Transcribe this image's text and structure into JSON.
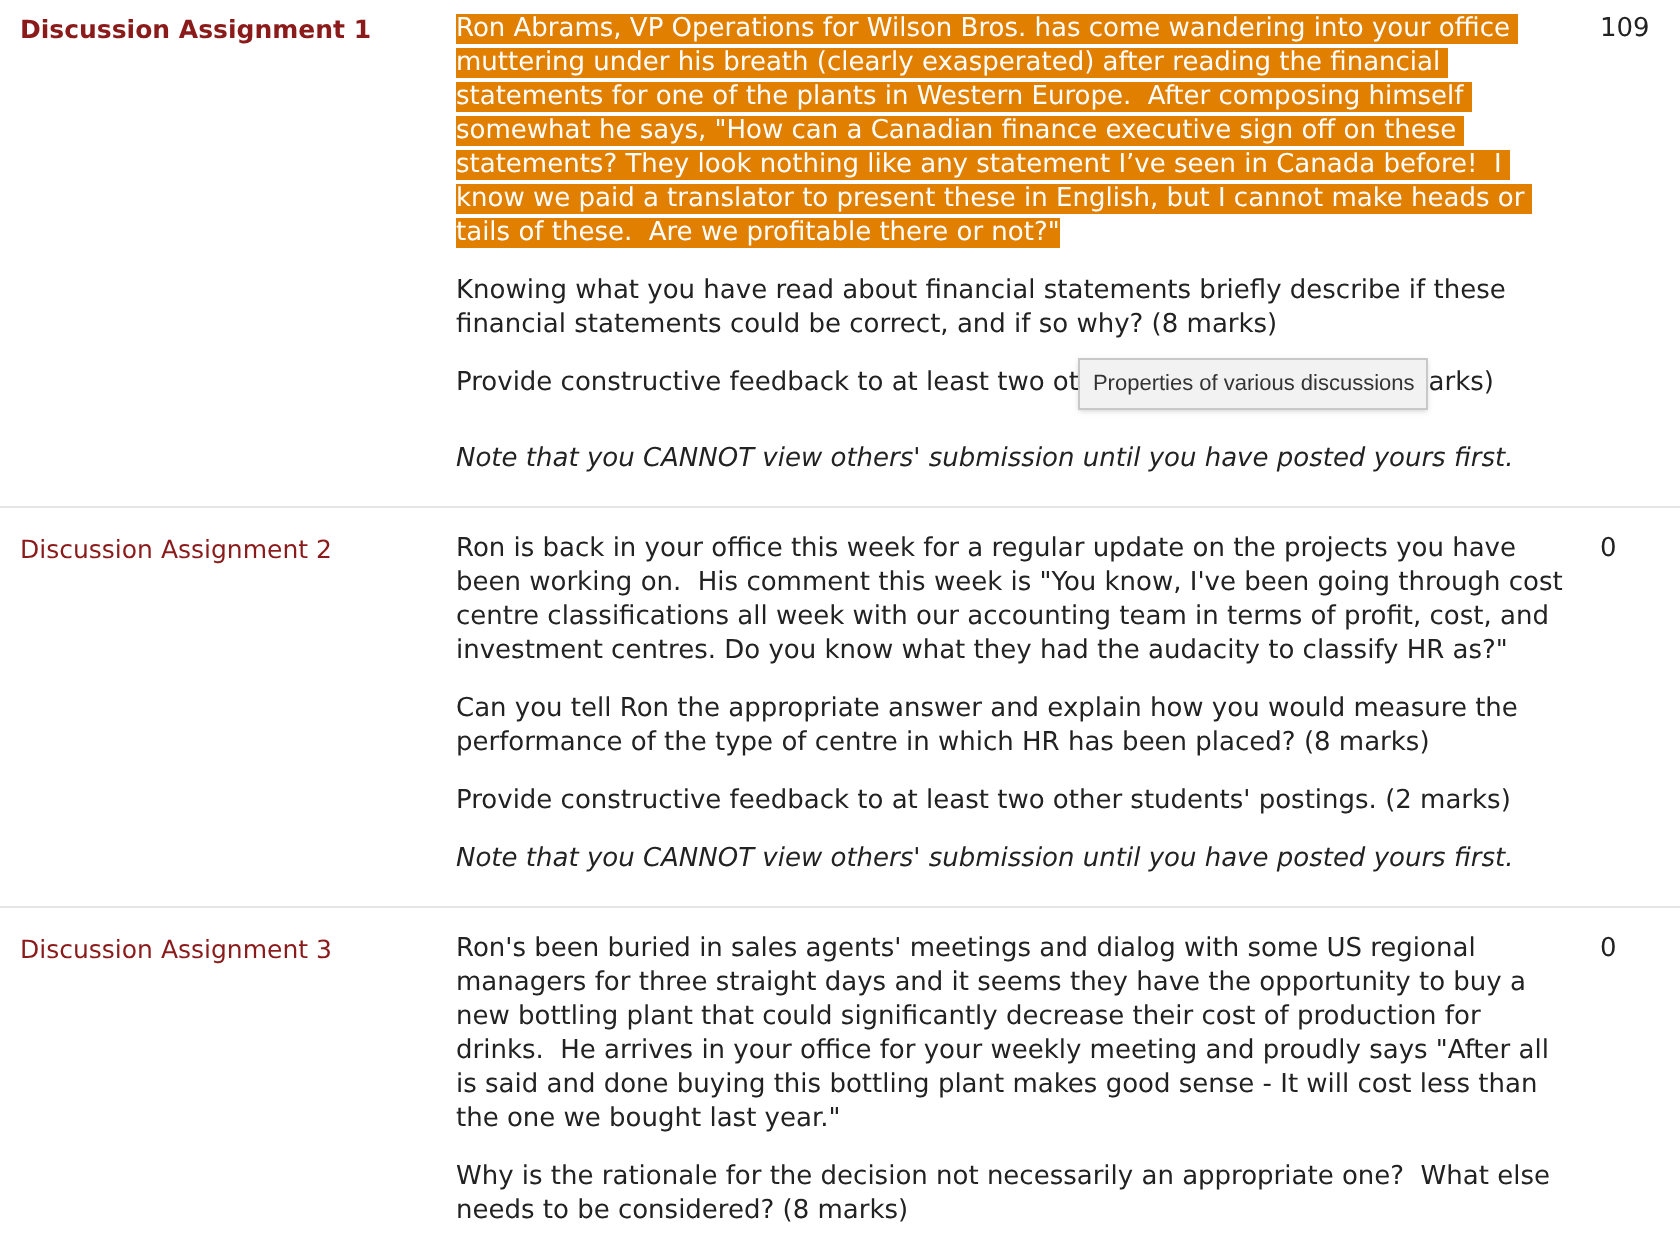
{
  "rows": [
    {
      "title": "Discussion Assignment 1",
      "selected": true,
      "count": "109",
      "paragraphs": [
        {
          "kind": "text",
          "highlighted": true,
          "text": "Ron Abrams, VP Operations for Wilson Bros. has come wandering into your office muttering under his breath (clearly exasperated) after reading the financial statements for one of the plants in Western Europe.  After composing himself somewhat he says, \"How can a Canadian finance executive sign off on these statements? They look nothing like any statement I’ve seen in Canada before!  I know we paid a translator to present these in English, but I cannot make heads or tails of these.  Are we profitable there or not?\""
        },
        {
          "kind": "text",
          "highlighted": false,
          "text": "Knowing what you have read about financial statements briefly describe if these financial statements could be correct, and if so why? (8 marks)"
        },
        {
          "kind": "covered",
          "before": "Provide constructive feedback to at least two ot",
          "tooltip": "Properties of various discussions",
          "after": "arks)"
        },
        {
          "kind": "note",
          "text": "Note that you CANNOT view others' submission until you have posted yours first."
        }
      ]
    },
    {
      "title": "Discussion Assignment 2",
      "selected": false,
      "count": "0",
      "paragraphs": [
        {
          "kind": "text",
          "highlighted": false,
          "text": "Ron is back in your office this week for a regular update on the projects you have been working on.  His comment this week is \"You know, I've been going through cost centre classifications all week with our accounting team in terms of profit, cost, and investment centres. Do you know what they had the audacity to classify HR as?\""
        },
        {
          "kind": "text",
          "highlighted": false,
          "text": "Can you tell Ron the appropriate answer and explain how you would measure the performance of the type of centre in which HR has been placed? (8 marks)"
        },
        {
          "kind": "text",
          "highlighted": false,
          "text": "Provide constructive feedback to at least two other students' postings. (2 marks)"
        },
        {
          "kind": "note",
          "text": "Note that you CANNOT view others' submission until you have posted yours first."
        }
      ]
    },
    {
      "title": "Discussion Assignment 3",
      "selected": false,
      "count": "0",
      "paragraphs": [
        {
          "kind": "text",
          "highlighted": false,
          "text": "Ron's been buried in sales agents' meetings and dialog with some US regional managers for three straight days and it seems they have the opportunity to buy a new bottling plant that could significantly decrease their cost of production for drinks.  He arrives in your office for your weekly meeting and proudly says \"After all is said and done buying this bottling plant makes good sense - It will cost less than the one we bought last year.\""
        },
        {
          "kind": "text",
          "highlighted": false,
          "text": "Why is the rationale for the decision not necessarily an appropriate one?  What else needs to be considered? (8 marks)"
        }
      ]
    }
  ]
}
